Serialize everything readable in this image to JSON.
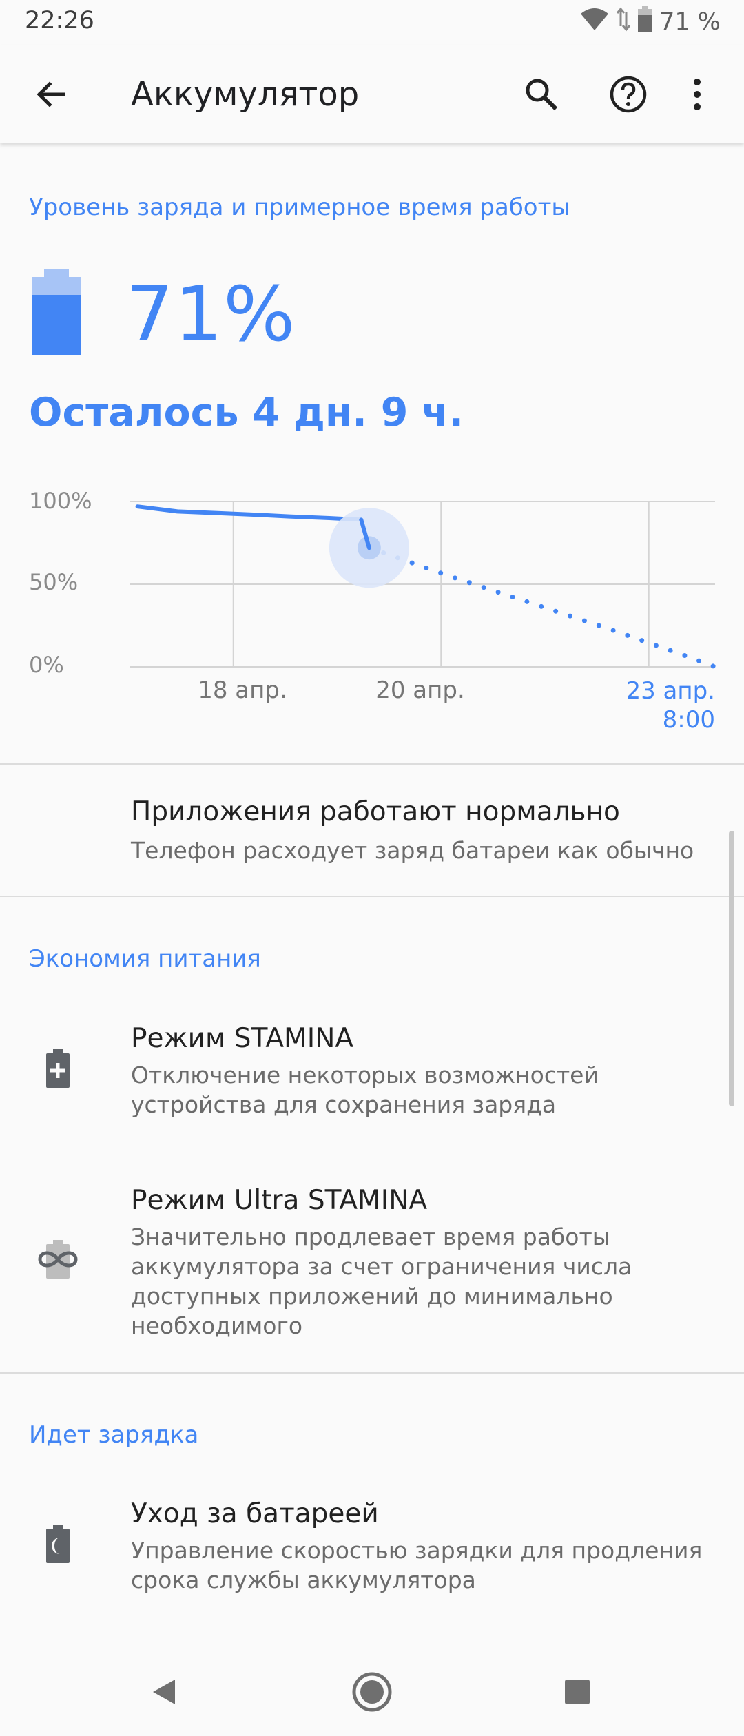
{
  "status_bar": {
    "time": "22:26",
    "battery_text": "71 %"
  },
  "app_bar": {
    "title": "Аккумулятор"
  },
  "battery": {
    "section_title": "Уровень заряда и примерное время работы",
    "percent_text": "71%",
    "level": 0.71,
    "remaining_text": "Осталось 4 дн. 9 ч."
  },
  "chart_data": {
    "type": "line",
    "y_ticks": [
      "100%",
      "50%",
      "0%"
    ],
    "x_ticks": [
      "18 апр.",
      "20 апр."
    ],
    "x_tick_highlight": [
      "23 апр.",
      "8:00"
    ],
    "ylim": [
      0,
      100
    ],
    "grid": true,
    "series": [
      {
        "style": "solid",
        "x": [
          16.1,
          16.6,
          17.1,
          17.6,
          18.0,
          18.5,
          18.9,
          19.0
        ],
        "y": [
          97,
          94,
          93,
          92,
          91,
          90,
          89,
          72
        ]
      },
      {
        "style": "dotted",
        "x": [
          19.0,
          20.0,
          21.0,
          22.0,
          23.0,
          23.33
        ],
        "y": [
          72,
          55,
          39,
          23,
          6,
          0
        ]
      }
    ],
    "colors": {
      "line": "#4285f4",
      "grid": "#d4d4d4",
      "marker_halo": "#dbe6f9"
    }
  },
  "apps_status": {
    "title": "Приложения работают нормально",
    "subtitle": "Телефон расходует заряд батареи как обычно"
  },
  "power_saving": {
    "section_title": "Экономия питания",
    "items": [
      {
        "title": "Режим STAMINA",
        "lines": [
          "Отключение некоторых возможностей",
          "устройства для сохранения заряда"
        ],
        "icon": "battery-plus-icon"
      },
      {
        "title": "Режим Ultra STAMINA",
        "lines": [
          "Значительно продлевает время работы",
          "аккумулятора за счет ограничения числа",
          "доступных приложений до минимально",
          "необходимого"
        ],
        "icon": "battery-infinity-icon"
      }
    ]
  },
  "charging": {
    "section_title": "Идет зарядка",
    "items": [
      {
        "title": "Уход за батареей",
        "lines": [
          "Управление скоростью зарядки для продления",
          "срока службы аккумулятора"
        ],
        "icon": "battery-moon-icon"
      }
    ]
  },
  "colors": {
    "accent": "#4285f4",
    "icon_gray": "#5f6368"
  }
}
